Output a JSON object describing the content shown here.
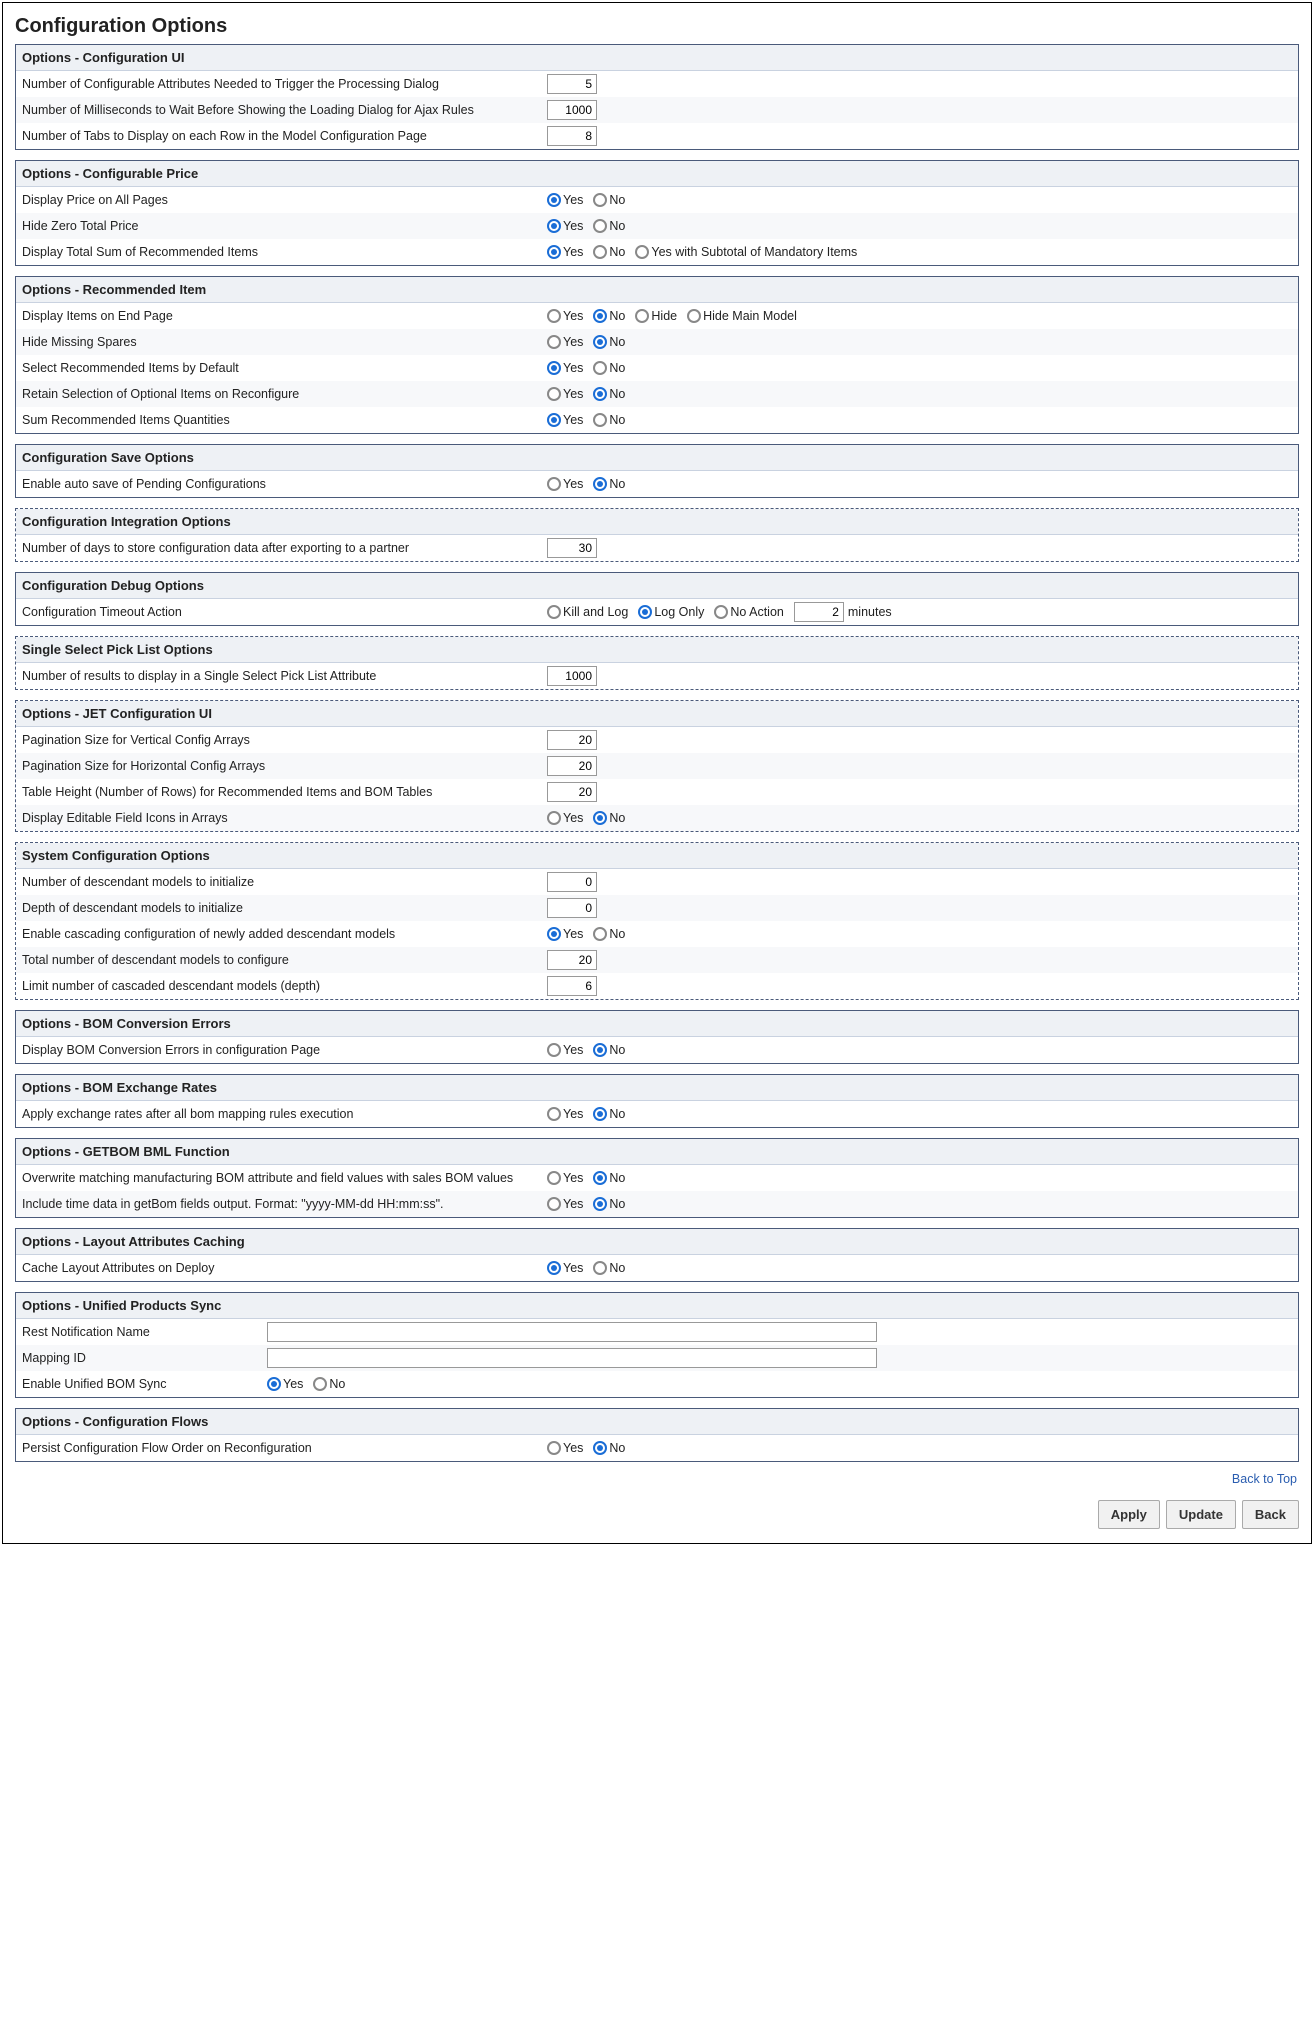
{
  "pageTitle": "Configuration Options",
  "labels": {
    "yes": "Yes",
    "no": "No",
    "hide": "Hide",
    "hideMainModel": "Hide Main Model",
    "yesSubtotal": "Yes with Subtotal of Mandatory Items",
    "killAndLog": "Kill and Log",
    "logOnly": "Log Only",
    "noAction": "No Action",
    "minutes": "minutes"
  },
  "sections": {
    "configUI": {
      "title": "Options - Configuration UI",
      "attrCount": {
        "label": "Number of Configurable Attributes Needed to Trigger the Processing Dialog",
        "value": "5"
      },
      "msWait": {
        "label": "Number of Milliseconds to Wait Before Showing the Loading Dialog for Ajax Rules",
        "value": "1000"
      },
      "tabsPerRow": {
        "label": "Number of Tabs to Display on each Row in the Model Configuration Page",
        "value": "8"
      }
    },
    "configPrice": {
      "title": "Options - Configurable Price",
      "displayAll": {
        "label": "Display Price on All Pages"
      },
      "hideZero": {
        "label": "Hide Zero Total Price"
      },
      "displaySum": {
        "label": "Display Total Sum of Recommended Items"
      }
    },
    "recItem": {
      "title": "Options - Recommended Item",
      "displayEnd": {
        "label": "Display Items on End Page"
      },
      "hideMissing": {
        "label": "Hide Missing Spares"
      },
      "selectDefault": {
        "label": "Select Recommended Items by Default"
      },
      "retainOptional": {
        "label": "Retain Selection of Optional Items on Reconfigure"
      },
      "sumQty": {
        "label": "Sum Recommended Items Quantities"
      }
    },
    "saveOpts": {
      "title": "Configuration Save Options",
      "autoSave": {
        "label": "Enable auto save of Pending Configurations"
      }
    },
    "integOpts": {
      "title": "Configuration Integration Options",
      "daysStore": {
        "label": "Number of days to store configuration data after exporting to a partner",
        "value": "30"
      }
    },
    "debugOpts": {
      "title": "Configuration Debug Options",
      "timeout": {
        "label": "Configuration Timeout Action",
        "value": "2"
      }
    },
    "pickList": {
      "title": "Single Select Pick List Options",
      "numResults": {
        "label": "Number of results to display in a Single Select Pick List Attribute",
        "value": "1000"
      }
    },
    "jetUI": {
      "title": "Options - JET Configuration UI",
      "pagV": {
        "label": "Pagination Size for Vertical Config Arrays",
        "value": "20"
      },
      "pagH": {
        "label": "Pagination Size for Horizontal Config Arrays",
        "value": "20"
      },
      "tableH": {
        "label": "Table Height (Number of Rows) for Recommended Items and BOM Tables",
        "value": "20"
      },
      "editIcons": {
        "label": "Display Editable Field Icons in Arrays"
      }
    },
    "sysConfig": {
      "title": "System Configuration Options",
      "numDesc": {
        "label": "Number of descendant models to initialize",
        "value": "0"
      },
      "depthDesc": {
        "label": "Depth of descendant models to initialize",
        "value": "0"
      },
      "cascading": {
        "label": "Enable cascading configuration of newly added descendant models"
      },
      "totalDesc": {
        "label": "Total number of descendant models to configure",
        "value": "20"
      },
      "limitDesc": {
        "label": "Limit number of cascaded descendant models (depth)",
        "value": "6"
      }
    },
    "bomConv": {
      "title": "Options - BOM Conversion Errors",
      "display": {
        "label": "Display BOM Conversion Errors in configuration Page"
      }
    },
    "bomExch": {
      "title": "Options - BOM Exchange Rates",
      "apply": {
        "label": "Apply exchange rates after all bom mapping rules execution"
      }
    },
    "getBom": {
      "title": "Options - GETBOM BML Function",
      "overwrite": {
        "label": "Overwrite matching manufacturing BOM attribute and field values with sales BOM values"
      },
      "includeTime": {
        "label": "Include time data in getBom fields output. Format: \"yyyy-MM-dd HH:mm:ss\"."
      }
    },
    "layoutCache": {
      "title": "Options - Layout Attributes Caching",
      "cache": {
        "label": "Cache Layout Attributes on Deploy"
      }
    },
    "unified": {
      "title": "Options - Unified Products Sync",
      "restName": {
        "label": "Rest Notification Name",
        "value": ""
      },
      "mappingId": {
        "label": "Mapping ID",
        "value": ""
      },
      "enableSync": {
        "label": "Enable Unified BOM Sync"
      }
    },
    "configFlows": {
      "title": "Options - Configuration Flows",
      "persist": {
        "label": "Persist Configuration Flow Order on Reconfiguration"
      }
    }
  },
  "footer": {
    "backToTop": "Back to Top",
    "apply": "Apply",
    "update": "Update",
    "back": "Back"
  }
}
